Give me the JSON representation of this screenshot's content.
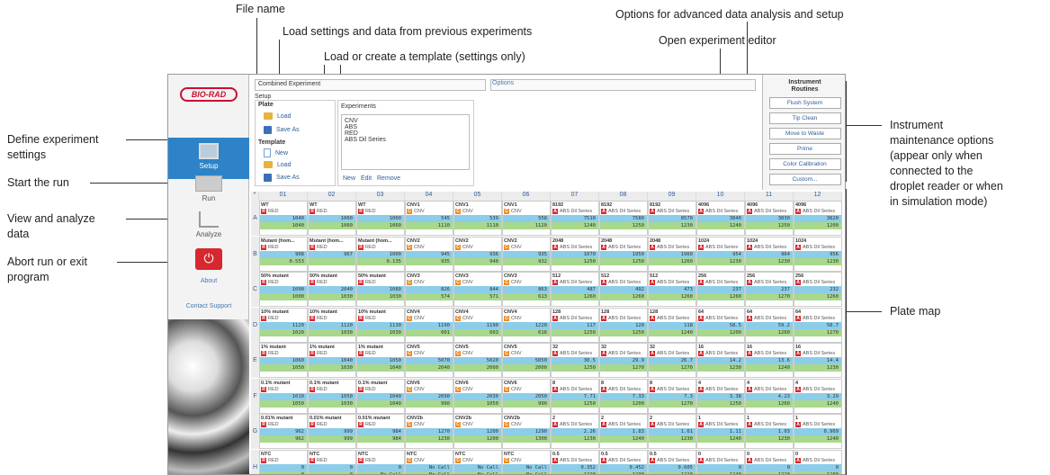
{
  "annotations": {
    "file_name": "File name",
    "options": "Options for advanced data analysis and setup",
    "load_settings": "Load settings and data from previous experiments",
    "open_editor": "Open experiment editor",
    "template": "Load or create a template (settings only)",
    "define": "Define experiment\nsettings",
    "start": "Start the run",
    "view": "View and analyze\ndata",
    "abort": "Abort run or exit\nprogram",
    "instrument": "Instrument\nmaintenance options\n(appear only when\nconnected to the\ndroplet reader or when\nin simulation mode)",
    "plate_map": "Plate map"
  },
  "sidebar": {
    "logo": "BIO-RAD",
    "setup": "Setup",
    "run": "Run",
    "analyze": "Analyze",
    "about": "About",
    "contact": "Contact Support"
  },
  "main": {
    "file_name": "Combined Experiment",
    "options": "Options",
    "setup": "Setup",
    "plate": "Plate",
    "load": "Load",
    "save_as": "Save As",
    "template": "Template",
    "new": "New",
    "template_load": "Load",
    "template_save_as": "Save As",
    "experiments_label": "Experiments",
    "experiments": "CNV\nABS\nRED\nABS Dil Series",
    "exp_new": "New",
    "exp_edit": "Edit",
    "exp_remove": "Remove"
  },
  "routines": {
    "title": "Instrument\nRoutines",
    "buttons": [
      "Flush System",
      "Tip Clean",
      "Move to Waste",
      "Prime",
      "Color Calibration",
      "Custom..."
    ]
  },
  "plate": {
    "corner": "*",
    "columns": [
      "01",
      "02",
      "03",
      "04",
      "05",
      "06",
      "07",
      "08",
      "09",
      "10",
      "11",
      "12"
    ],
    "rows": [
      "A",
      "B",
      "C",
      "D",
      "E",
      "F",
      "G",
      "H"
    ],
    "wells": [
      [
        [
          "WT",
          "R",
          "RED",
          "1040",
          "1040"
        ],
        [
          "WT",
          "R",
          "RED",
          "1060",
          "1060"
        ],
        [
          "WT",
          "R",
          "RED",
          "1060",
          "1060"
        ],
        [
          "CNV1",
          "C",
          "CNV",
          "545",
          "1110"
        ],
        [
          "CNV1",
          "C",
          "CNV",
          "539",
          "1110"
        ],
        [
          "CNV1",
          "C",
          "CNV",
          "558",
          "1120"
        ],
        [
          "8192",
          "A",
          "ABS Dil Series",
          "7510",
          "1240"
        ],
        [
          "8192",
          "A",
          "ABS Dil Series",
          "7580",
          "1250"
        ],
        [
          "8192",
          "A",
          "ABS Dil Series",
          "8570",
          "1230"
        ],
        [
          "4096",
          "A",
          "ABS Dil Series",
          "3840",
          "1240"
        ],
        [
          "4096",
          "A",
          "ABS Dil Series",
          "3830",
          "1250"
        ],
        [
          "4096",
          "A",
          "ABS Dil Series",
          "3820",
          "1200"
        ]
      ],
      [
        [
          "Mutant (hom...",
          "R",
          "RED",
          "908",
          "0.553"
        ],
        [
          "Mutant (hom...",
          "R",
          "RED",
          "967",
          ""
        ],
        [
          "Mutant (hom...",
          "R",
          "RED",
          "1000",
          "0.135"
        ],
        [
          "CNV2",
          "C",
          "CNV",
          "945",
          "935"
        ],
        [
          "CNV2",
          "C",
          "CNV",
          "936",
          "940"
        ],
        [
          "CNV2",
          "C",
          "CNV",
          "935",
          "932"
        ],
        [
          "2048",
          "A",
          "ABS Dil Series",
          "1070",
          "1250"
        ],
        [
          "2048",
          "A",
          "ABS Dil Series",
          "1950",
          "1250"
        ],
        [
          "2048",
          "A",
          "ABS Dil Series",
          "1960",
          "1260"
        ],
        [
          "1024",
          "A",
          "ABS Dil Series",
          "954",
          "1230"
        ],
        [
          "1024",
          "A",
          "ABS Dil Series",
          "964",
          "1230"
        ],
        [
          "1024",
          "A",
          "ABS Dil Series",
          "956",
          "1230"
        ]
      ],
      [
        [
          "50% mutant",
          "R",
          "RED",
          "1090",
          "1000"
        ],
        [
          "50% mutant",
          "R",
          "RED",
          "2040",
          "1030"
        ],
        [
          "50% mutant",
          "R",
          "RED",
          "1080",
          "1030"
        ],
        [
          "CNV3",
          "C",
          "CNV",
          "826",
          "574"
        ],
        [
          "CNV3",
          "C",
          "CNV",
          "844",
          "571"
        ],
        [
          "CNV3",
          "C",
          "CNV",
          "863",
          "613"
        ],
        [
          "512",
          "A",
          "ABS Dil Series",
          "487",
          "1260"
        ],
        [
          "512",
          "A",
          "ABS Dil Series",
          "492",
          "1260"
        ],
        [
          "512",
          "A",
          "ABS Dil Series",
          "473",
          "1260"
        ],
        [
          "256",
          "A",
          "ABS Dil Series",
          "237",
          "1260"
        ],
        [
          "256",
          "A",
          "ABS Dil Series",
          "237",
          "1270"
        ],
        [
          "256",
          "A",
          "ABS Dil Series",
          "232",
          "1260"
        ]
      ],
      [
        [
          "10% mutant",
          "R",
          "RED",
          "1120",
          "1020"
        ],
        [
          "10% mutant",
          "R",
          "RED",
          "1120",
          "1030"
        ],
        [
          "10% mutant",
          "R",
          "RED",
          "1130",
          "1030"
        ],
        [
          "CNV4",
          "C",
          "CNV",
          "1190",
          "601"
        ],
        [
          "CNV4",
          "C",
          "CNV",
          "1190",
          "603"
        ],
        [
          "CNV4",
          "C",
          "CNV",
          "1220",
          "616"
        ],
        [
          "128",
          "A",
          "ABS Dil Series",
          "117",
          "1250"
        ],
        [
          "128",
          "A",
          "ABS Dil Series",
          "120",
          "1250"
        ],
        [
          "128",
          "A",
          "ABS Dil Series",
          "118",
          "1240"
        ],
        [
          "64",
          "A",
          "ABS Dil Series",
          "58.5",
          "1200"
        ],
        [
          "64",
          "A",
          "ABS Dil Series",
          "59.2",
          "1260"
        ],
        [
          "64",
          "A",
          "ABS Dil Series",
          "58.7",
          "1270"
        ]
      ],
      [
        [
          "1% mutant",
          "R",
          "RED",
          "1060",
          "1050"
        ],
        [
          "1% mutant",
          "R",
          "RED",
          "1040",
          "1030"
        ],
        [
          "1% mutant",
          "R",
          "RED",
          "1050",
          "1040"
        ],
        [
          "CNV5",
          "C",
          "CNV",
          "5070",
          "2040"
        ],
        [
          "CNV5",
          "C",
          "CNV",
          "5020",
          "2000"
        ],
        [
          "CNV5",
          "C",
          "CNV",
          "5050",
          "2000"
        ],
        [
          "32",
          "A",
          "ABS Dil Series",
          "30.5",
          "1250"
        ],
        [
          "32",
          "A",
          "ABS Dil Series",
          "29.9",
          "1270"
        ],
        [
          "32",
          "A",
          "ABS Dil Series",
          "26.7",
          "1270"
        ],
        [
          "16",
          "A",
          "ABS Dil Series",
          "14.2",
          "1230"
        ],
        [
          "16",
          "A",
          "ABS Dil Series",
          "13.6",
          "1240"
        ],
        [
          "16",
          "A",
          "ABS Dil Series",
          "14.4",
          "1230"
        ]
      ],
      [
        [
          "0.1% mutant",
          "R",
          "RED",
          "1010",
          "1050"
        ],
        [
          "0.1% mutant",
          "R",
          "RED",
          "1050",
          "1030"
        ],
        [
          "0.1% mutant",
          "R",
          "RED",
          "1040",
          "1040"
        ],
        [
          "CNV6",
          "C",
          "CNV",
          "2090",
          "990"
        ],
        [
          "CNV6",
          "C",
          "CNV",
          "2030",
          "1050"
        ],
        [
          "CNV6",
          "C",
          "CNV",
          "2050",
          "990"
        ],
        [
          "8",
          "A",
          "ABS Dil Series",
          "7.71",
          "1250"
        ],
        [
          "8",
          "A",
          "ABS Dil Series",
          "7.33",
          "1200"
        ],
        [
          "8",
          "A",
          "ABS Dil Series",
          "7.3",
          "1270"
        ],
        [
          "4",
          "A",
          "ABS Dil Series",
          "3.38",
          "1250"
        ],
        [
          "4",
          "A",
          "ABS Dil Series",
          "4.23",
          "1260"
        ],
        [
          "4",
          "A",
          "ABS Dil Series",
          "3.29",
          "1240"
        ]
      ],
      [
        [
          "0.01% mutant",
          "R",
          "RED",
          "962",
          "962"
        ],
        [
          "0.01% mutant",
          "R",
          "RED",
          "999",
          "999"
        ],
        [
          "0.01% mutant",
          "R",
          "RED",
          "984",
          "984"
        ],
        [
          "CNV2b",
          "C",
          "CNV",
          "1270",
          "1230"
        ],
        [
          "CNV2b",
          "C",
          "CNV",
          "1200",
          "1200"
        ],
        [
          "CNV2b",
          "C",
          "CNV",
          "1290",
          "1300"
        ],
        [
          "2",
          "A",
          "ABS Dil Series",
          "2.26",
          "1230"
        ],
        [
          "2",
          "A",
          "ABS Dil Series",
          "1.83",
          "1240"
        ],
        [
          "2",
          "A",
          "ABS Dil Series",
          "1.61",
          "1230"
        ],
        [
          "1",
          "A",
          "ABS Dil Series",
          "1.11",
          "1240"
        ],
        [
          "1",
          "A",
          "ABS Dil Series",
          "1.03",
          "1230"
        ],
        [
          "1",
          "A",
          "ABS Dil Series",
          "0.969",
          "1240"
        ]
      ],
      [
        [
          "NTC",
          "R",
          "RED",
          "0",
          "0"
        ],
        [
          "NTC",
          "R",
          "RED",
          "0",
          "0"
        ],
        [
          "NTC",
          "R",
          "RED",
          "0",
          "No Call"
        ],
        [
          "NTC",
          "C",
          "CNV",
          "No Call",
          "No Call"
        ],
        [
          "NTC",
          "C",
          "CNV",
          "No Call",
          "No Call"
        ],
        [
          "NTC",
          "C",
          "CNV",
          "No Call",
          "No Call"
        ],
        [
          "0.5",
          "A",
          "ABS Dil Series",
          "0.352",
          "1220"
        ],
        [
          "0.5",
          "A",
          "ABS Dil Series",
          "0.452",
          "1230"
        ],
        [
          "0.5",
          "A",
          "ABS Dil Series",
          "0.605",
          "1210"
        ],
        [
          "0",
          "A",
          "ABS Dil Series",
          "0",
          "1240"
        ],
        [
          "0",
          "A",
          "ABS Dil Series",
          "0",
          "1220"
        ],
        [
          "0",
          "A",
          "ABS Dil Series",
          "0",
          "1200"
        ]
      ]
    ]
  },
  "colors": {
    "R": "#d6282e",
    "C": "#f08a24",
    "A": "#d6282e",
    "accent": "#2e83c8"
  }
}
